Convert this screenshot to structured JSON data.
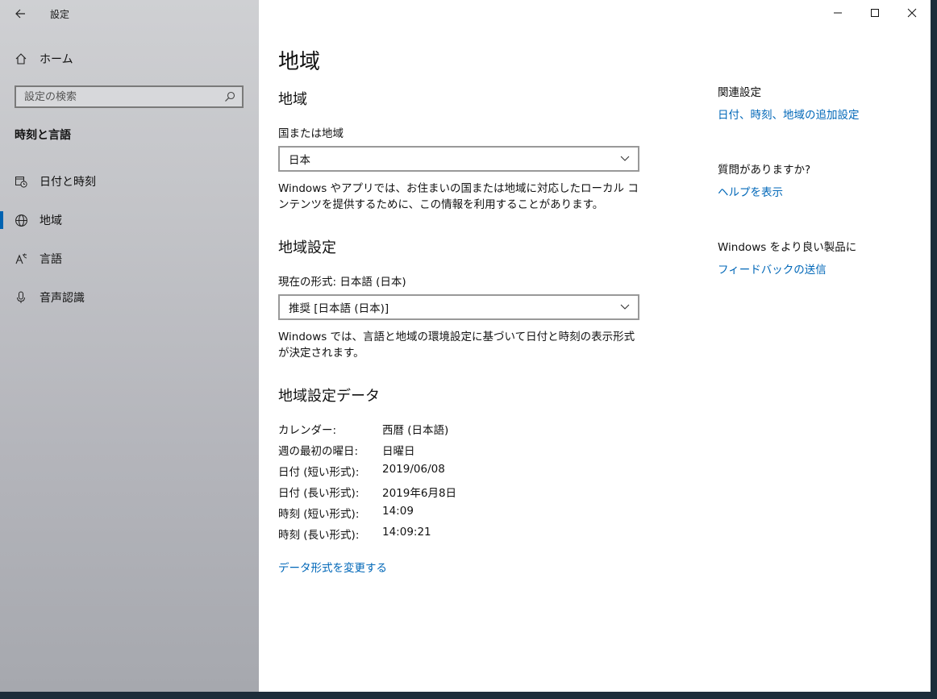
{
  "app": {
    "title": "設定"
  },
  "sidebar": {
    "home_label": "ホーム",
    "search_placeholder": "設定の検索",
    "section_label": "時刻と言語",
    "items": [
      {
        "label": "日付と時刻",
        "icon": "calendar-clock-icon"
      },
      {
        "label": "地域",
        "icon": "globe-icon",
        "active": true
      },
      {
        "label": "言語",
        "icon": "language-icon"
      },
      {
        "label": "音声認識",
        "icon": "microphone-icon"
      }
    ]
  },
  "main": {
    "title": "地域",
    "region": {
      "heading": "地域",
      "country_label": "国または地域",
      "country_value": "日本",
      "description": "Windows やアプリでは、お住まいの国または地域に対応したローカル コンテンツを提供するために、この情報を利用することがあります。"
    },
    "format": {
      "heading": "地域設定",
      "current_label": "現在の形式: 日本語 (日本)",
      "value": "推奨 [日本語 (日本)]",
      "description": "Windows では、言語と地域の環境設定に基づいて日付と時刻の表示形式が決定されます。"
    },
    "data": {
      "heading": "地域設定データ",
      "rows": [
        {
          "key": "カレンダー:",
          "value": "西暦 (日本語)"
        },
        {
          "key": "週の最初の曜日:",
          "value": "日曜日"
        },
        {
          "key": "日付 (短い形式):",
          "value": "2019/06/08"
        },
        {
          "key": "日付 (長い形式):",
          "value": "2019年6月8日"
        },
        {
          "key": "時刻 (短い形式):",
          "value": "14:09"
        },
        {
          "key": "時刻 (長い形式):",
          "value": "14:09:21"
        }
      ],
      "change_link": "データ形式を変更する"
    }
  },
  "right": {
    "related_heading": "関連設定",
    "related_link": "日付、時刻、地域の追加設定",
    "question_heading": "質問がありますか?",
    "help_link": "ヘルプを表示",
    "improve_heading": "Windows をより良い製品に",
    "feedback_link": "フィードバックの送信"
  },
  "colors": {
    "accent": "#0063b1",
    "link": "#0067b8"
  }
}
